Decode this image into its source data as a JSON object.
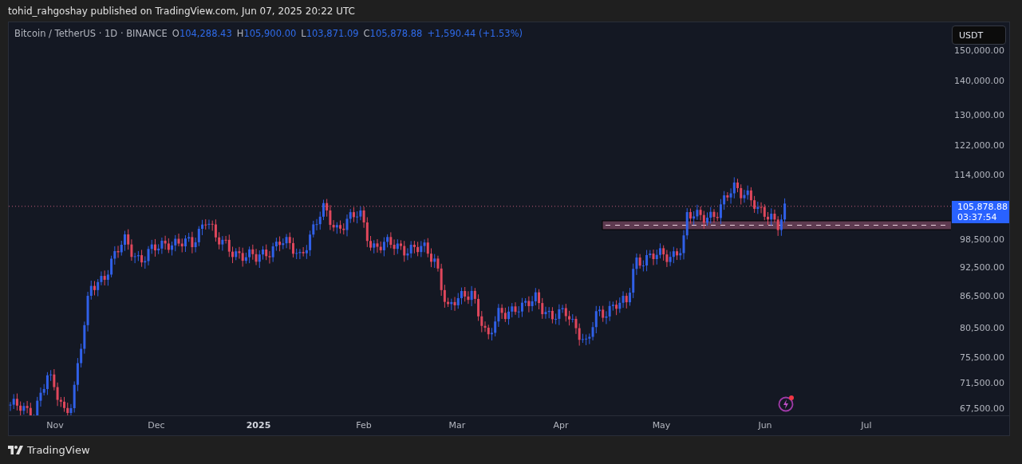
{
  "header": {
    "text": "tohid_rahgoshay published on TradingView.com, Jun 07, 2025 20:22 UTC"
  },
  "legend": {
    "symbol": "Bitcoin / TetherUS · 1D · BINANCE",
    "ohlc": [
      {
        "label": "O",
        "value": "104,288.43"
      },
      {
        "label": "H",
        "value": "105,900.00"
      },
      {
        "label": "L",
        "value": "103,871.09"
      },
      {
        "label": "C",
        "value": "105,878.88"
      }
    ],
    "change": "+1,590.44 (+1.53%)"
  },
  "currency_button": "USDT",
  "price_axis": [
    "150,000.00",
    "140,000.00",
    "130,000.00",
    "122,000.00",
    "114,000.00",
    "98,500.00",
    "92,500.00",
    "86,500.00",
    "80,500.00",
    "75,500.00",
    "71,500.00",
    "67,500.00"
  ],
  "last_price": {
    "price": "105,878.88",
    "countdown": "03:37:54"
  },
  "time_axis": [
    {
      "label": "Nov",
      "kind": "month"
    },
    {
      "label": "Dec",
      "kind": "month"
    },
    {
      "label": "2025",
      "kind": "year"
    },
    {
      "label": "Feb",
      "kind": "month"
    },
    {
      "label": "Mar",
      "kind": "month"
    },
    {
      "label": "Apr",
      "kind": "month"
    },
    {
      "label": "May",
      "kind": "month"
    },
    {
      "label": "Jun",
      "kind": "month"
    },
    {
      "label": "Jul",
      "kind": "month"
    }
  ],
  "footer": {
    "brand": "TradingView"
  }
}
